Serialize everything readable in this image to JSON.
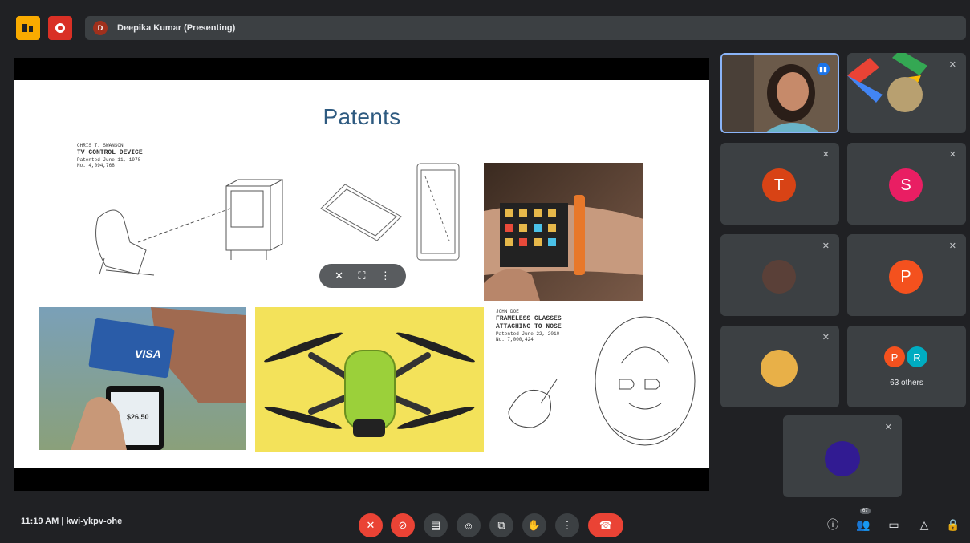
{
  "presenter": {
    "initial": "D",
    "label": "Deepika Kumar (Presenting)"
  },
  "slide": {
    "title": "Patents",
    "patent1": {
      "line1": "CHRIS T. SWANSON",
      "line2": "TV CONTROL DEVICE",
      "line3": "Patented June 11, 1978",
      "line4": "No. 4,094,768"
    },
    "patent2": {
      "line1": "JOHN DOE",
      "line2": "FRAMELESS GLASSES",
      "line3": "ATTACHING TO NOSE",
      "line4": "Patented June 22, 2010",
      "line5": "No. 7,000,424"
    },
    "card_text": "VISA",
    "phone_amount": "$26.50"
  },
  "participants": [
    {
      "id": "p1",
      "type": "video"
    },
    {
      "id": "p2",
      "type": "photo"
    },
    {
      "id": "p3",
      "initial": "T",
      "color": "#d84315"
    },
    {
      "id": "p4",
      "initial": "S",
      "color": "#e91e63"
    },
    {
      "id": "p5",
      "type": "photo"
    },
    {
      "id": "p6",
      "initial": "P",
      "color": "#f4511e"
    },
    {
      "id": "p7",
      "type": "photo"
    },
    {
      "id": "p8",
      "initials": [
        "P",
        "R"
      ],
      "others": "63 others"
    },
    {
      "id": "p9",
      "color": "#311b92"
    }
  ],
  "bottom": {
    "time": "11:19 AM",
    "meeting_code": "kwi-ykpv-ohe",
    "people_count": "67"
  },
  "colors": {
    "accent_red": "#ea4335",
    "tile_bg": "#3c4043",
    "bg": "#202124"
  }
}
